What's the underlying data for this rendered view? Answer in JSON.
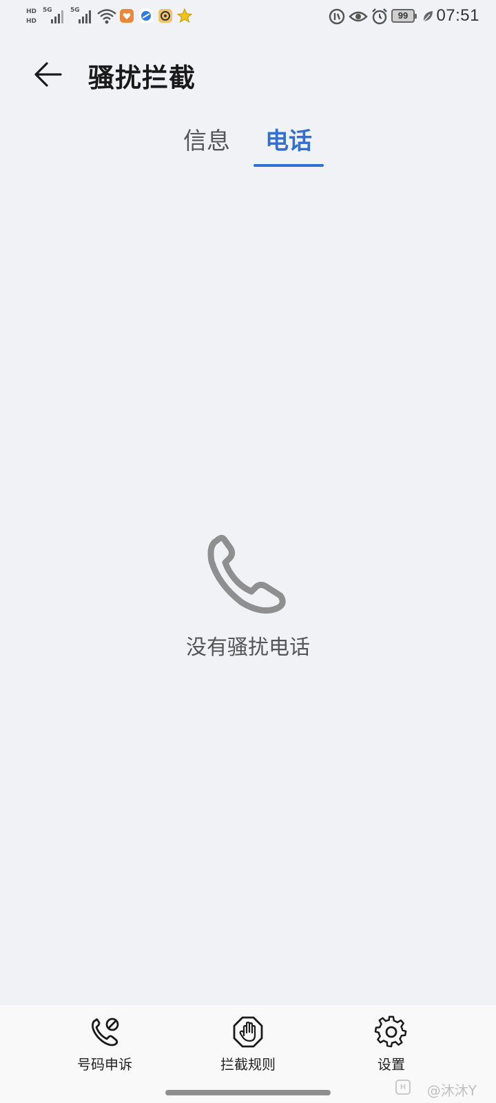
{
  "status_bar": {
    "network_1": "5G",
    "network_2": "5G",
    "battery": "99",
    "time": "07:51",
    "sim_labels": [
      "HD",
      "HD"
    ],
    "icons": [
      "hd-icon",
      "signal-icon",
      "signal-icon",
      "wifi-icon",
      "app-icon",
      "app-icon",
      "app-icon",
      "star-icon",
      "vpn-icon",
      "eye-icon",
      "alarm-icon",
      "battery-icon",
      "leaf-icon"
    ]
  },
  "header": {
    "title": "骚扰拦截"
  },
  "tabs": [
    {
      "label": "信息",
      "active": false
    },
    {
      "label": "电话",
      "active": true
    }
  ],
  "empty_state": {
    "text": "没有骚扰电话",
    "icon": "phone-icon"
  },
  "bottom_nav": [
    {
      "label": "号码申诉",
      "icon": "phone-block-icon"
    },
    {
      "label": "拦截规则",
      "icon": "hand-stop-icon"
    },
    {
      "label": "设置",
      "icon": "gear-icon"
    }
  ],
  "watermark": {
    "text": "@沐沐Y",
    "logo": "H"
  },
  "colors": {
    "accent": "#2f6fd6",
    "background": "#f1f2f6",
    "bottom_nav_bg": "#f9f9f9"
  }
}
